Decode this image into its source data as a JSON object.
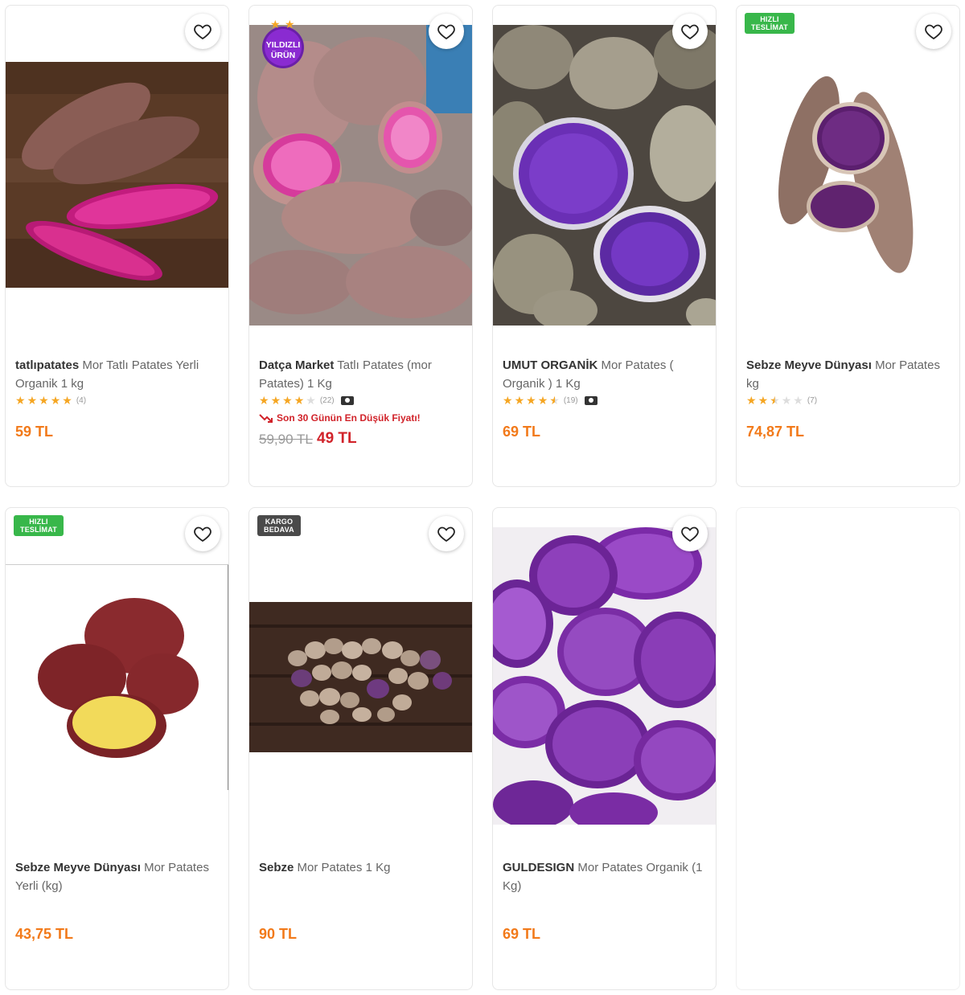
{
  "colors": {
    "accent": "#f27a1a",
    "discount": "#d1232a",
    "star": "#f5a623",
    "fast_badge": "#38b74a",
    "cargo_badge": "#4a4a4a"
  },
  "products": [
    {
      "brand": "tatlıpatates",
      "title": "Mor Tatlı Patates Yerli Organik 1 kg",
      "stars": 5,
      "reviews": "(4)",
      "price": "59 TL",
      "favorite_icon": "heart-icon"
    },
    {
      "brand": "Datça Market",
      "title": "Tatlı Patates (mor Patates) 1 Kg",
      "stars": 4,
      "reviews": "(22)",
      "badge_line1": "YILDIZLI",
      "badge_line2": "ÜRÜN",
      "lowest_price_text": "Son 30 Günün En Düşük Fiyatı!",
      "old_price": "59,90 TL",
      "price": "49 TL",
      "favorite_icon": "heart-icon"
    },
    {
      "brand": "UMUT ORGANİK",
      "title": "Mor Patates ( Organik ) 1 Kg",
      "stars": 4.5,
      "reviews": "(19)",
      "price": "69 TL",
      "favorite_icon": "heart-icon"
    },
    {
      "brand": "Sebze Meyve Dünyası",
      "title": "Mor Patates kg",
      "stars": 2.5,
      "reviews": "(7)",
      "badge_line1": "HIZLI",
      "badge_line2": "TESLİMAT",
      "price": "74,87 TL",
      "favorite_icon": "heart-icon"
    },
    {
      "brand": "Sebze Meyve Dünyası",
      "title": "Mor Patates Yerli (kg)",
      "badge_line1": "HIZLI",
      "badge_line2": "TESLİMAT",
      "price": "43,75 TL",
      "favorite_icon": "heart-icon"
    },
    {
      "brand": "Sebze",
      "title": "Mor Patates 1 Kg",
      "badge_line1": "KARGO",
      "badge_line2": "BEDAVA",
      "price": "90 TL",
      "favorite_icon": "heart-icon"
    },
    {
      "brand": "GULDESIGN",
      "title": "Mor Patates Organik (1 Kg)",
      "price": "69 TL",
      "favorite_icon": "heart-icon"
    }
  ]
}
